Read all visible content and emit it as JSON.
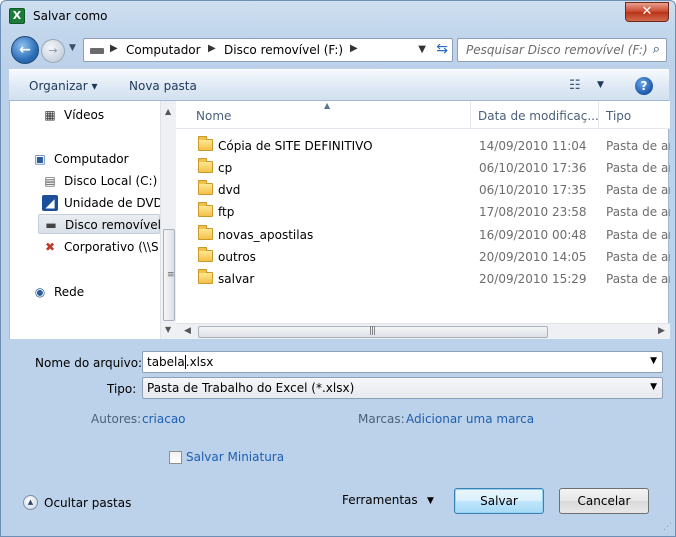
{
  "window": {
    "title": "Salvar como",
    "close_glyph": "✕"
  },
  "nav": {
    "breadcrumbs": [
      "Computador",
      "Disco removível (F:)"
    ],
    "search_placeholder": "Pesquisar Disco removível (F:)"
  },
  "toolbar": {
    "organize_label": "Organizar ▾",
    "new_folder_label": "Nova pasta",
    "help_glyph": "?"
  },
  "sidebar": {
    "items": [
      {
        "label": "Vídeos",
        "icon": "video-icon"
      },
      {
        "label": "Computador",
        "icon": "computer-icon"
      },
      {
        "label": "Disco Local (C:)",
        "icon": "hard-drive-icon"
      },
      {
        "label": "Unidade de DVD",
        "icon": "dvd-icon"
      },
      {
        "label": "Disco removível",
        "icon": "removable-drive-icon",
        "selected": true
      },
      {
        "label": "Corporativo (\\\\S",
        "icon": "network-drive-icon"
      },
      {
        "label": "Rede",
        "icon": "network-icon"
      }
    ]
  },
  "files": {
    "columns": {
      "name": "Nome",
      "date": "Data de modificaç...",
      "type": "Tipo"
    },
    "rows": [
      {
        "name": "Cópia de SITE DEFINITIVO",
        "date": "14/09/2010 11:04",
        "type": "Pasta de arquivos"
      },
      {
        "name": "cp",
        "date": "06/10/2010 17:36",
        "type": "Pasta de arquivos"
      },
      {
        "name": "dvd",
        "date": "06/10/2010 17:35",
        "type": "Pasta de arquivos"
      },
      {
        "name": "ftp",
        "date": "17/08/2010 23:58",
        "type": "Pasta de arquivos"
      },
      {
        "name": "novas_apostilas",
        "date": "16/09/2010 00:48",
        "type": "Pasta de arquivos"
      },
      {
        "name": "outros",
        "date": "20/09/2010 14:05",
        "type": "Pasta de arquivos"
      },
      {
        "name": "salvar",
        "date": "20/09/2010 15:29",
        "type": "Pasta de arquivos"
      }
    ]
  },
  "form": {
    "filename_label": "Nome do arquivo:",
    "filename_before_caret": "tabela",
    "filename_after_caret": ".xlsx",
    "type_label": "Tipo:",
    "type_value": "Pasta de Trabalho do Excel (*.xlsx)",
    "authors_label": "Autores:",
    "authors_value": "criacao",
    "tags_label": "Marcas:",
    "tags_value": "Adicionar uma marca",
    "thumbnail_label": "Salvar Miniatura"
  },
  "footer": {
    "hide_folders_label": "Ocultar pastas",
    "tools_label": "Ferramentas",
    "save_label": "Salvar",
    "cancel_label": "Cancelar"
  }
}
